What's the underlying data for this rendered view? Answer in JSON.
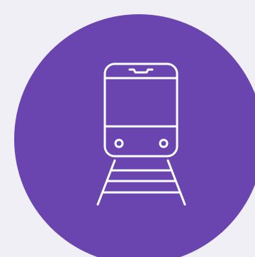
{
  "background_color": "#f0eff5",
  "badge": {
    "color": "#6a45b0",
    "icon": "train-icon",
    "icon_color": "#ffffff"
  }
}
